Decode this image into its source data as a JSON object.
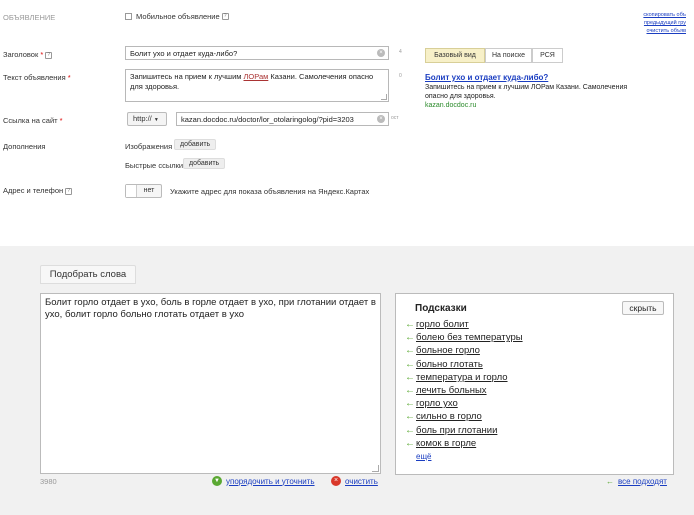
{
  "form": {
    "section_title": "ОБЪЯВЛЕНИЕ",
    "mobile_label": "Мобильное объявление",
    "copy_links": [
      "скопировать объ",
      "предыдущий гру",
      "очистить объяв"
    ],
    "headline_label": "Заголовок",
    "headline_value": "Болит ухо и отдает куда-либо?",
    "headline_counter": "4",
    "text_label": "Текст объявления",
    "text_value_before": "Запишитесь на прием к лучшим ",
    "text_value_link": "ЛОРам",
    "text_value_after": " Казани. Самолечения опасно для здоровья.",
    "text_counter": "0",
    "url_label": "Ссылка на сайт",
    "protocol": "http://",
    "url_value": "kazan.docdoc.ru/doctor/lor_otolaringolog/?pid=3203",
    "url_counter": "ост",
    "extras_label": "Дополнения",
    "images_label": "Изображения",
    "images_add": "добавить",
    "quicklinks_label": "Быстрые ссылки",
    "quicklinks_add": "добавить",
    "address_label": "Адрес и телефон",
    "address_toggle": "нет",
    "address_hint": "Укажите адрес для показа объявления на Яндекс.Картах"
  },
  "preview": {
    "tabs": [
      "Базовый вид",
      "На поиске",
      "РСЯ"
    ],
    "active_tab": 0,
    "title": "Болит ухо и отдает куда-либо?",
    "body": "Запишитесь на прием к лучшим ЛОРам Казани. Самолечения опасно для здоровья.",
    "domain": "kazan.docdoc.ru"
  },
  "wordpicker": {
    "tab_label": "Подобрать слова",
    "text": "Болит горло отдает в ухо, боль в горле отдает в ухо, при глотании отдает в ухо, болит горло больно глотать отдает в ухо",
    "char_count": "3980",
    "sort_label": "упорядочить и уточнить",
    "clear_label": "очистить",
    "all_fit_label": "все подходят"
  },
  "suggestions": {
    "title": "Подсказки",
    "hide_label": "скрыть",
    "items": [
      "горло болит",
      "болею без температуры",
      "больное горло",
      "больно глотать",
      "температура и горло",
      "лечить больных",
      "горло ухо",
      "сильно в горло",
      "боль при глотании",
      "комок в горле"
    ],
    "more_label": "ещё"
  },
  "colors": {
    "link": "#1a3dc1",
    "accent_green": "#5aa832",
    "clear_red": "#d9382a",
    "active_tab": "#f7f0c8"
  }
}
